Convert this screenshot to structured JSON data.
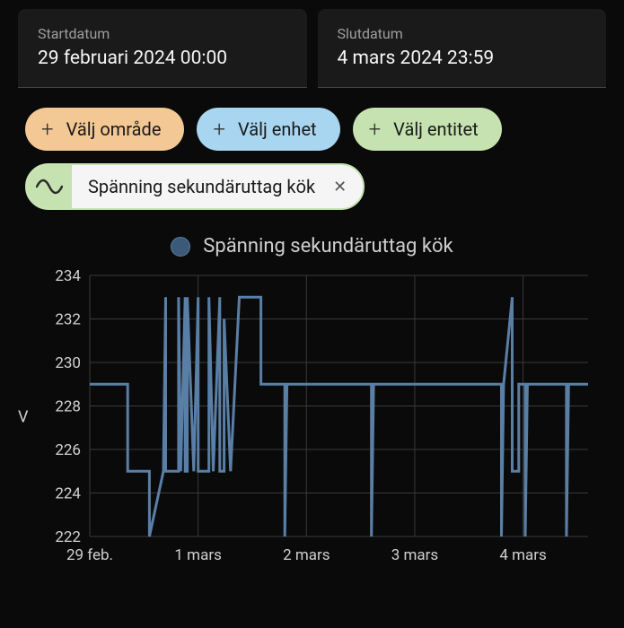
{
  "dates": {
    "start_label": "Startdatum",
    "start_value": "29 februari 2024 00:00",
    "end_label": "Slutdatum",
    "end_value": "4 mars 2024 23:59"
  },
  "chips": {
    "area": "Välj område",
    "device": "Välj enhet",
    "entity": "Välj entitet"
  },
  "selected_entity": "Spänning sekundäruttag kök",
  "legend": "Spänning sekundäruttag kök",
  "y_unit": "V",
  "chart_data": {
    "type": "line",
    "title": "Spänning sekundäruttag kök",
    "xlabel": "",
    "ylabel": "V",
    "ylim": [
      222,
      234
    ],
    "x_ticks": [
      "29 feb.",
      "1 mars",
      "2 mars",
      "3 mars",
      "4 mars"
    ],
    "y_ticks": [
      222,
      224,
      226,
      228,
      230,
      232,
      234
    ],
    "series": [
      {
        "name": "Spänning sekundäruttag kök",
        "x": [
          0,
          0.35,
          0.35,
          0.55,
          0.55,
          0.68,
          0.68,
          0.7,
          0.7,
          0.82,
          0.82,
          0.84,
          0.84,
          0.88,
          0.88,
          0.9,
          0.9,
          0.96,
          0.96,
          1.0,
          1.0,
          1.1,
          1.1,
          1.14,
          1.14,
          1.2,
          1.2,
          1.24,
          1.24,
          1.3,
          1.3,
          1.38,
          1.38,
          1.58,
          1.58,
          1.8,
          1.8,
          1.82,
          1.82,
          2.6,
          2.6,
          2.62,
          2.62,
          3.8,
          3.8,
          3.82,
          3.82,
          3.9,
          3.9,
          3.96,
          3.96,
          4.02,
          4.02,
          4.04,
          4.04,
          4.4,
          4.4,
          4.42,
          4.42,
          4.6
        ],
        "y": [
          229,
          229,
          225,
          225,
          222,
          225,
          225,
          233,
          225,
          225,
          233,
          225,
          225,
          233,
          225,
          225,
          233,
          225,
          225,
          233,
          225,
          225,
          233,
          225,
          225,
          233,
          225,
          225,
          232,
          225,
          225,
          233,
          233,
          233,
          229,
          229,
          222,
          229,
          229,
          229,
          222,
          229,
          229,
          229,
          222,
          229,
          229,
          233,
          225,
          225,
          229,
          229,
          222,
          229,
          229,
          229,
          222,
          229,
          229,
          229
        ]
      }
    ]
  }
}
